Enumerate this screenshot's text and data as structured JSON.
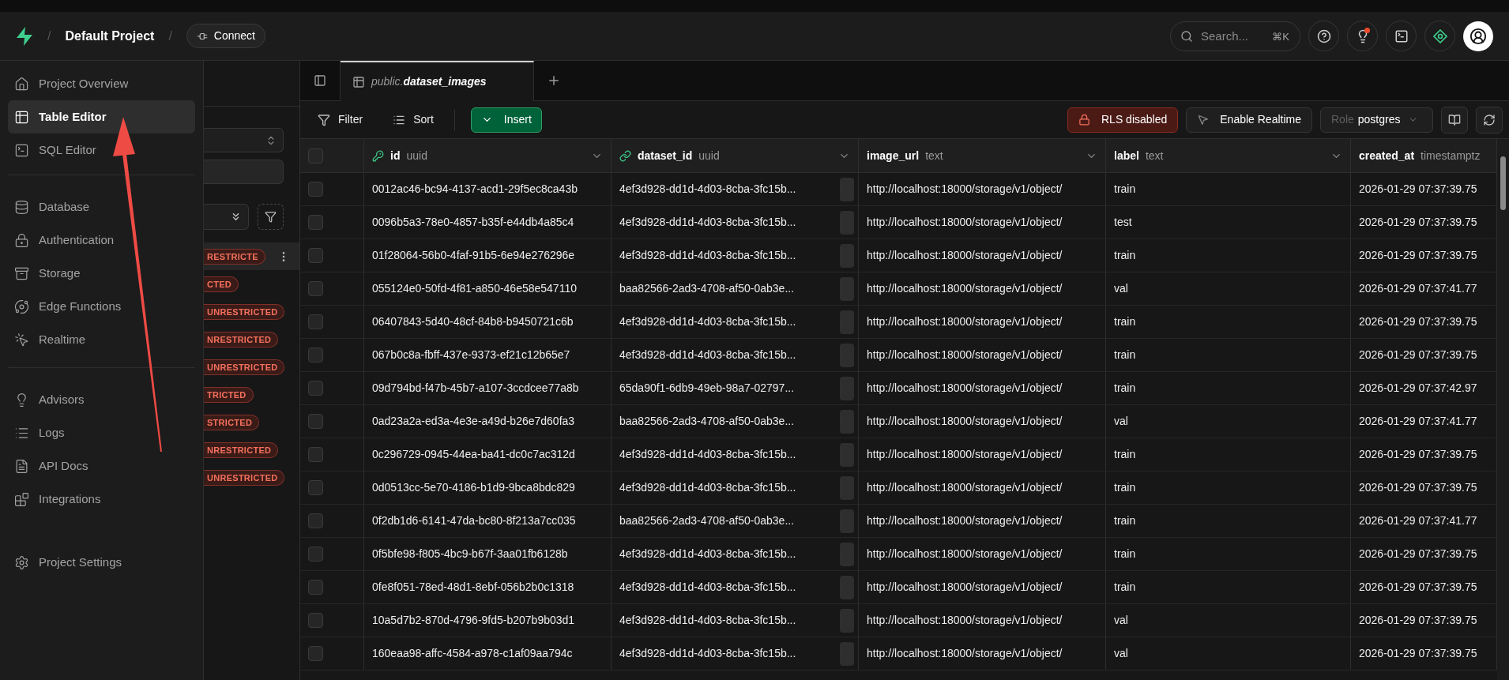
{
  "header": {
    "breadcrumb_separators": [
      "/",
      "/"
    ],
    "project": "Default Project",
    "connect": "Connect",
    "search": {
      "placeholder": "Search..."
    },
    "shortcut": "⌘K"
  },
  "sidebar": {
    "groups": [
      {
        "items": [
          {
            "label": "Project Overview",
            "selected": false
          },
          {
            "label": "Table Editor",
            "selected": true
          },
          {
            "label": "SQL Editor",
            "selected": false
          }
        ]
      },
      {
        "items": [
          {
            "label": "Database",
            "selected": false
          },
          {
            "label": "Authentication",
            "selected": false
          },
          {
            "label": "Storage",
            "selected": false
          },
          {
            "label": "Edge Functions",
            "selected": false
          },
          {
            "label": "Realtime",
            "selected": false
          }
        ]
      },
      {
        "items": [
          {
            "label": "Advisors",
            "selected": false
          },
          {
            "label": "Logs",
            "selected": false
          },
          {
            "label": "API Docs",
            "selected": false
          },
          {
            "label": "Integrations",
            "selected": false
          }
        ]
      },
      {
        "items": [
          {
            "label": "Project Settings",
            "selected": false
          }
        ]
      }
    ]
  },
  "table_list": {
    "items": [
      {
        "badge": "RESTRICTE",
        "selected": true
      },
      {
        "badge": "CTED",
        "selected": false
      },
      {
        "badge": "UNRESTRICTED",
        "selected": false
      },
      {
        "badge": "NRESTRICTED",
        "selected": false
      },
      {
        "badge": "UNRESTRICTED",
        "selected": false
      },
      {
        "badge": "TRICTED",
        "selected": false
      },
      {
        "badge": "STRICTED",
        "selected": false
      },
      {
        "badge": "NRESTRICTED",
        "selected": false
      },
      {
        "badge": "UNRESTRICTED",
        "selected": false
      }
    ]
  },
  "tabs": [
    {
      "schema": "public.",
      "table": "dataset_images",
      "selected": true
    }
  ],
  "toolbar": {
    "filter": "Filter",
    "sort": "Sort",
    "insert": "Insert",
    "rls": "RLS disabled",
    "realtime": "Enable Realtime",
    "role_label": "Role",
    "role": "postgres"
  },
  "table": {
    "all_checked": false,
    "columns": [
      {
        "name": "id",
        "type": "uuid",
        "kind": "primary_key"
      },
      {
        "name": "dataset_id",
        "type": "uuid",
        "kind": "foreign_key"
      },
      {
        "name": "image_url",
        "type": "text",
        "kind": "plain"
      },
      {
        "name": "label",
        "type": "text",
        "kind": "plain"
      },
      {
        "name": "created_at",
        "type": "timestamptz",
        "kind": "plain"
      }
    ],
    "rows": [
      {
        "checked": false,
        "cells": [
          "0012ac46-bc94-4137-acd1-29f5ec8ca43b",
          "4ef3d928-dd1d-4d03-8cba-3fc15b...",
          "http://localhost:18000/storage/v1/object/",
          "train",
          "2026-01-29 07:37:39.75"
        ]
      },
      {
        "checked": false,
        "cells": [
          "0096b5a3-78e0-4857-b35f-e44db4a85c4",
          "4ef3d928-dd1d-4d03-8cba-3fc15b...",
          "http://localhost:18000/storage/v1/object/",
          "test",
          "2026-01-29 07:37:39.75"
        ]
      },
      {
        "checked": false,
        "cells": [
          "01f28064-56b0-4faf-91b5-6e94e276296e",
          "4ef3d928-dd1d-4d03-8cba-3fc15b...",
          "http://localhost:18000/storage/v1/object/",
          "train",
          "2026-01-29 07:37:39.75"
        ]
      },
      {
        "checked": false,
        "cells": [
          "055124e0-50fd-4f81-a850-46e58e547110",
          "baa82566-2ad3-4708-af50-0ab3e...",
          "http://localhost:18000/storage/v1/object/",
          "val",
          "2026-01-29 07:37:41.77"
        ]
      },
      {
        "checked": false,
        "cells": [
          "06407843-5d40-48cf-84b8-b9450721c6b",
          "4ef3d928-dd1d-4d03-8cba-3fc15b...",
          "http://localhost:18000/storage/v1/object/",
          "train",
          "2026-01-29 07:37:39.75"
        ]
      },
      {
        "checked": false,
        "cells": [
          "067b0c8a-fbff-437e-9373-ef21c12b65e7",
          "4ef3d928-dd1d-4d03-8cba-3fc15b...",
          "http://localhost:18000/storage/v1/object/",
          "train",
          "2026-01-29 07:37:39.75"
        ]
      },
      {
        "checked": false,
        "cells": [
          "09d794bd-f47b-45b7-a107-3ccdcee77a8b",
          "65da90f1-6db9-49eb-98a7-02797...",
          "http://localhost:18000/storage/v1/object/",
          "train",
          "2026-01-29 07:37:42.97"
        ]
      },
      {
        "checked": false,
        "cells": [
          "0ad23a2a-ed3a-4e3e-a49d-b26e7d60fa3",
          "baa82566-2ad3-4708-af50-0ab3e...",
          "http://localhost:18000/storage/v1/object/",
          "val",
          "2026-01-29 07:37:41.77"
        ]
      },
      {
        "checked": false,
        "cells": [
          "0c296729-0945-44ea-ba41-dc0c7ac312d",
          "4ef3d928-dd1d-4d03-8cba-3fc15b...",
          "http://localhost:18000/storage/v1/object/",
          "train",
          "2026-01-29 07:37:39.75"
        ]
      },
      {
        "checked": false,
        "cells": [
          "0d0513cc-5e70-4186-b1d9-9bca8bdc829",
          "4ef3d928-dd1d-4d03-8cba-3fc15b...",
          "http://localhost:18000/storage/v1/object/",
          "train",
          "2026-01-29 07:37:39.75"
        ]
      },
      {
        "checked": false,
        "cells": [
          "0f2db1d6-6141-47da-bc80-8f213a7cc035",
          "baa82566-2ad3-4708-af50-0ab3e...",
          "http://localhost:18000/storage/v1/object/",
          "train",
          "2026-01-29 07:37:41.77"
        ]
      },
      {
        "checked": false,
        "cells": [
          "0f5bfe98-f805-4bc9-b67f-3aa01fb6128b",
          "4ef3d928-dd1d-4d03-8cba-3fc15b...",
          "http://localhost:18000/storage/v1/object/",
          "train",
          "2026-01-29 07:37:39.75"
        ]
      },
      {
        "checked": false,
        "cells": [
          "0fe8f051-78ed-48d1-8ebf-056b2b0c1318",
          "4ef3d928-dd1d-4d03-8cba-3fc15b...",
          "http://localhost:18000/storage/v1/object/",
          "train",
          "2026-01-29 07:37:39.75"
        ]
      },
      {
        "checked": false,
        "cells": [
          "10a5d7b2-870d-4796-9fd5-b207b9b03d1",
          "4ef3d928-dd1d-4d03-8cba-3fc15b...",
          "http://localhost:18000/storage/v1/object/",
          "val",
          "2026-01-29 07:37:39.75"
        ]
      },
      {
        "checked": false,
        "cells": [
          "160eaa98-affc-4584-a978-c1af09aa794c",
          "4ef3d928-dd1d-4d03-8cba-3fc15b...",
          "http://localhost:18000/storage/v1/object/",
          "val",
          "2026-01-29 07:37:39.75"
        ]
      }
    ]
  }
}
